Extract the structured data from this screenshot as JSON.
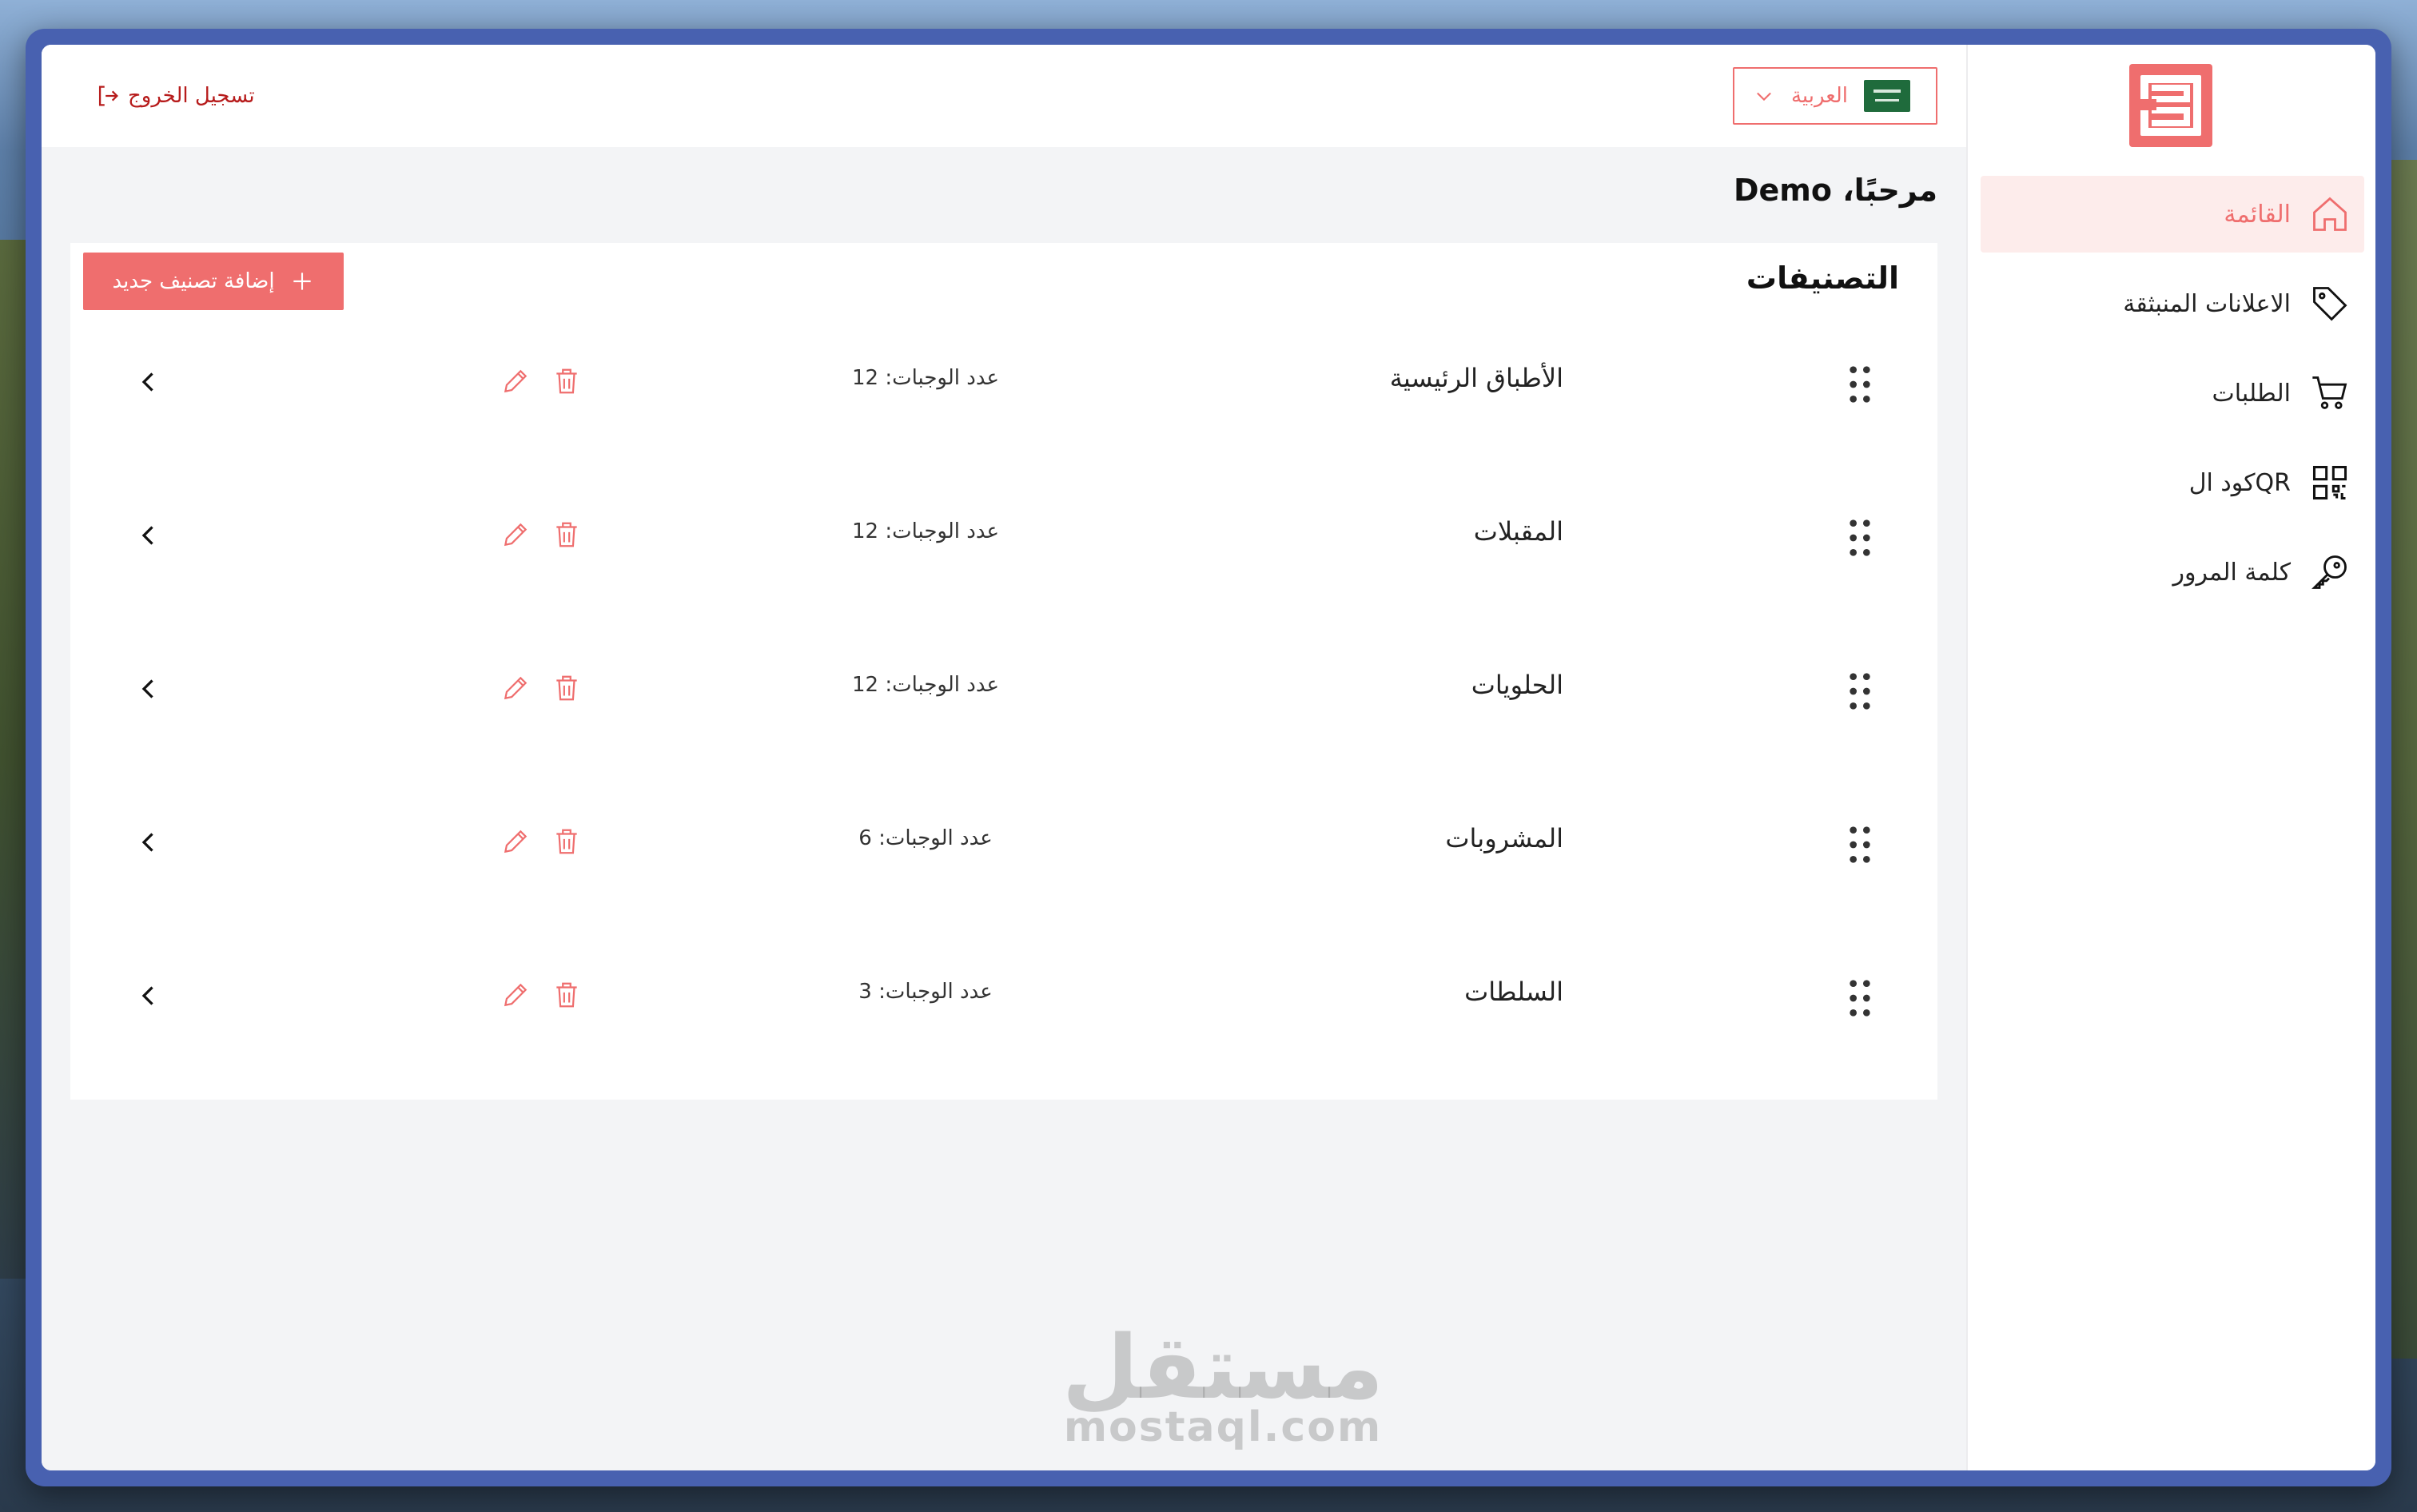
{
  "sidebar": {
    "items": [
      {
        "label": "القائمة",
        "icon": "home-icon",
        "active": true
      },
      {
        "label": "الاعلانات المنبثقة",
        "icon": "tag-icon",
        "active": false
      },
      {
        "label": "الطلبات",
        "icon": "cart-icon",
        "active": false
      },
      {
        "label": "كود الQR",
        "icon": "qr-code-icon",
        "active": false
      },
      {
        "label": "كلمة المرور",
        "icon": "key-icon",
        "active": false
      }
    ]
  },
  "header": {
    "language_label": "العربية",
    "logout_label": "تسجيل الخروج"
  },
  "main": {
    "welcome": "مرحبًا، Demo",
    "panel_title": "التصنيفات",
    "add_button_label": "إضافة تصنيف جديد",
    "categories": [
      {
        "name": "الأطباق الرئيسية",
        "count_label": "عدد الوجبات: 12"
      },
      {
        "name": "المقبلات",
        "count_label": "عدد الوجبات: 12"
      },
      {
        "name": "الحلويات",
        "count_label": "عدد الوجبات: 12"
      },
      {
        "name": "المشروبات",
        "count_label": "عدد الوجبات: 6"
      },
      {
        "name": "السلطات",
        "count_label": "عدد الوجبات: 3"
      }
    ]
  },
  "watermark": {
    "ar": "مستقل",
    "en": "mostaql.com"
  },
  "colors": {
    "accent": "#ef6e6e",
    "active_bg": "#fdeceb",
    "logout": "#b71c1c",
    "frame": "#4861b0"
  }
}
